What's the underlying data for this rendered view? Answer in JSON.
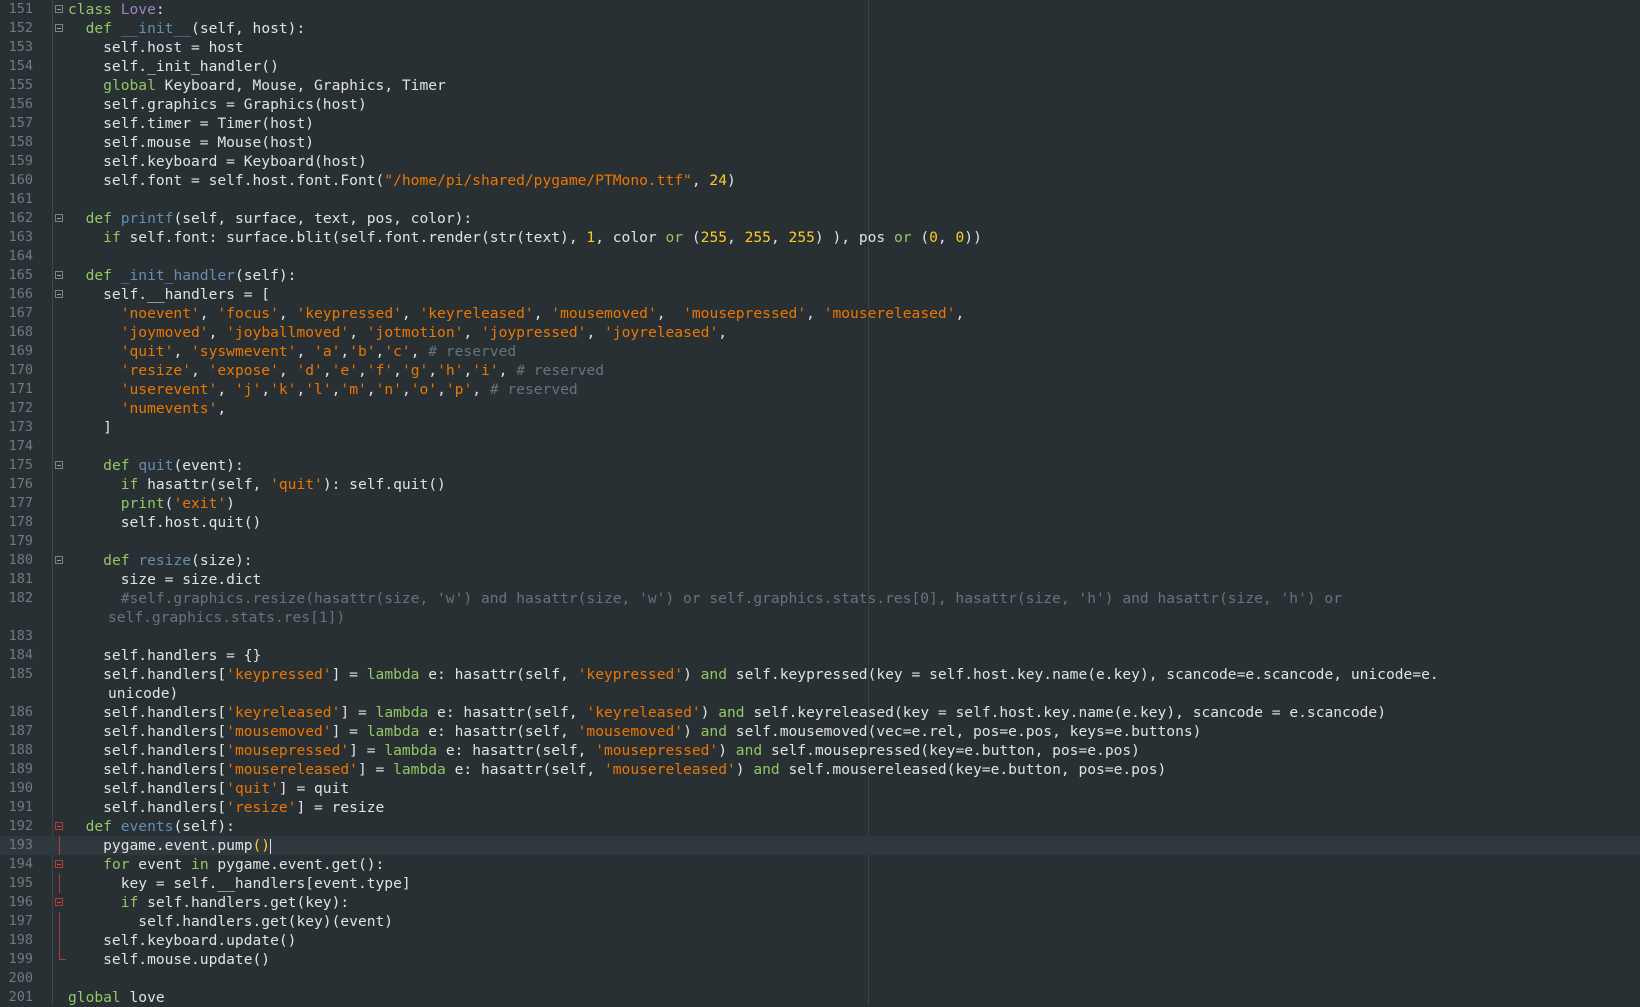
{
  "editor": {
    "lines": [
      {
        "n": "151",
        "fold": "box",
        "tokens": [
          [
            "kw",
            "class "
          ],
          [
            "cl",
            "Love"
          ],
          [
            "",
            ":"
          ]
        ]
      },
      {
        "n": "152",
        "fold": "box",
        "tokens": [
          [
            "",
            "  "
          ],
          [
            "kw",
            "def "
          ],
          [
            "fn",
            "__init__"
          ],
          [
            "",
            "(self, host):"
          ]
        ]
      },
      {
        "n": "153",
        "tokens": [
          [
            "",
            "    self.host = host"
          ]
        ]
      },
      {
        "n": "154",
        "tokens": [
          [
            "",
            "    self._init_handler()"
          ]
        ]
      },
      {
        "n": "155",
        "tokens": [
          [
            "",
            "    "
          ],
          [
            "kw",
            "global"
          ],
          [
            "",
            " Keyboard, Mouse, Graphics, Timer"
          ]
        ]
      },
      {
        "n": "156",
        "tokens": [
          [
            "",
            "    self.graphics = Graphics(host)"
          ]
        ]
      },
      {
        "n": "157",
        "tokens": [
          [
            "",
            "    self.timer = Timer(host)"
          ]
        ]
      },
      {
        "n": "158",
        "tokens": [
          [
            "",
            "    self.mouse = Mouse(host)"
          ]
        ]
      },
      {
        "n": "159",
        "tokens": [
          [
            "",
            "    self.keyboard = Keyboard(host)"
          ]
        ]
      },
      {
        "n": "160",
        "tokens": [
          [
            "",
            "    self.font = self.host.font.Font("
          ],
          [
            "st",
            "\"/home/pi/shared/pygame/PTMono.ttf\""
          ],
          [
            "",
            ", "
          ],
          [
            "nu",
            "24"
          ],
          [
            "",
            ")"
          ]
        ]
      },
      {
        "n": "161",
        "tokens": []
      },
      {
        "n": "162",
        "fold": "box",
        "tokens": [
          [
            "",
            "  "
          ],
          [
            "kw",
            "def "
          ],
          [
            "fn",
            "printf"
          ],
          [
            "",
            "(self, surface, text, pos, color):"
          ]
        ]
      },
      {
        "n": "163",
        "tokens": [
          [
            "",
            "    "
          ],
          [
            "kw",
            "if"
          ],
          [
            "",
            " self.font: surface.blit(self.font.render(str(text), "
          ],
          [
            "nu",
            "1"
          ],
          [
            "",
            ", color "
          ],
          [
            "kw",
            "or"
          ],
          [
            "",
            " ("
          ],
          [
            "nu",
            "255"
          ],
          [
            "",
            ", "
          ],
          [
            "nu",
            "255"
          ],
          [
            "",
            ", "
          ],
          [
            "nu",
            "255"
          ],
          [
            "",
            ") ), pos "
          ],
          [
            "kw",
            "or"
          ],
          [
            "",
            " ("
          ],
          [
            "nu",
            "0"
          ],
          [
            "",
            ", "
          ],
          [
            "nu",
            "0"
          ],
          [
            "",
            "))"
          ]
        ]
      },
      {
        "n": "164",
        "tokens": []
      },
      {
        "n": "165",
        "fold": "box",
        "tokens": [
          [
            "",
            "  "
          ],
          [
            "kw",
            "def "
          ],
          [
            "fn",
            "_init_handler"
          ],
          [
            "",
            "(self):"
          ]
        ]
      },
      {
        "n": "166",
        "fold": "box",
        "tokens": [
          [
            "",
            "    self.__handlers = ["
          ]
        ]
      },
      {
        "n": "167",
        "tokens": [
          [
            "",
            "      "
          ],
          [
            "st",
            "'noevent'"
          ],
          [
            "",
            ", "
          ],
          [
            "st",
            "'focus'"
          ],
          [
            "",
            ", "
          ],
          [
            "st",
            "'keypressed'"
          ],
          [
            "",
            ", "
          ],
          [
            "st",
            "'keyreleased'"
          ],
          [
            "",
            ", "
          ],
          [
            "st",
            "'mousemoved'"
          ],
          [
            "",
            ",  "
          ],
          [
            "st",
            "'mousepressed'"
          ],
          [
            "",
            ", "
          ],
          [
            "st",
            "'mousereleased'"
          ],
          [
            "",
            ","
          ]
        ]
      },
      {
        "n": "168",
        "tokens": [
          [
            "",
            "      "
          ],
          [
            "st",
            "'joymoved'"
          ],
          [
            "",
            ", "
          ],
          [
            "st",
            "'joyballmoved'"
          ],
          [
            "",
            ", "
          ],
          [
            "st",
            "'jotmotion'"
          ],
          [
            "",
            ", "
          ],
          [
            "st",
            "'joypressed'"
          ],
          [
            "",
            ", "
          ],
          [
            "st",
            "'joyreleased'"
          ],
          [
            "",
            ","
          ]
        ]
      },
      {
        "n": "169",
        "tokens": [
          [
            "",
            "      "
          ],
          [
            "st",
            "'quit'"
          ],
          [
            "",
            ", "
          ],
          [
            "st",
            "'syswmevent'"
          ],
          [
            "",
            ", "
          ],
          [
            "st",
            "'a'"
          ],
          [
            "",
            ","
          ],
          [
            "st",
            "'b'"
          ],
          [
            "",
            ","
          ],
          [
            "st",
            "'c'"
          ],
          [
            "",
            ", "
          ],
          [
            "cm",
            "# reserved"
          ]
        ]
      },
      {
        "n": "170",
        "tokens": [
          [
            "",
            "      "
          ],
          [
            "st",
            "'resize'"
          ],
          [
            "",
            ", "
          ],
          [
            "st",
            "'expose'"
          ],
          [
            "",
            ", "
          ],
          [
            "st",
            "'d'"
          ],
          [
            "",
            ","
          ],
          [
            "st",
            "'e'"
          ],
          [
            "",
            ","
          ],
          [
            "st",
            "'f'"
          ],
          [
            "",
            ","
          ],
          [
            "st",
            "'g'"
          ],
          [
            "",
            ","
          ],
          [
            "st",
            "'h'"
          ],
          [
            "",
            ","
          ],
          [
            "st",
            "'i'"
          ],
          [
            "",
            ", "
          ],
          [
            "cm",
            "# reserved"
          ]
        ]
      },
      {
        "n": "171",
        "tokens": [
          [
            "",
            "      "
          ],
          [
            "st",
            "'userevent'"
          ],
          [
            "",
            ", "
          ],
          [
            "st",
            "'j'"
          ],
          [
            "",
            ","
          ],
          [
            "st",
            "'k'"
          ],
          [
            "",
            ","
          ],
          [
            "st",
            "'l'"
          ],
          [
            "",
            ","
          ],
          [
            "st",
            "'m'"
          ],
          [
            "",
            ","
          ],
          [
            "st",
            "'n'"
          ],
          [
            "",
            ","
          ],
          [
            "st",
            "'o'"
          ],
          [
            "",
            ","
          ],
          [
            "st",
            "'p'"
          ],
          [
            "",
            ", "
          ],
          [
            "cm",
            "# reserved"
          ]
        ]
      },
      {
        "n": "172",
        "tokens": [
          [
            "",
            "      "
          ],
          [
            "st",
            "'numevents'"
          ],
          [
            "",
            ","
          ]
        ]
      },
      {
        "n": "173",
        "tokens": [
          [
            "",
            "    ]"
          ]
        ]
      },
      {
        "n": "174",
        "tokens": []
      },
      {
        "n": "175",
        "fold": "box",
        "tokens": [
          [
            "",
            "    "
          ],
          [
            "kw",
            "def "
          ],
          [
            "fn",
            "quit"
          ],
          [
            "",
            "(event):"
          ]
        ]
      },
      {
        "n": "176",
        "tokens": [
          [
            "",
            "      "
          ],
          [
            "kw",
            "if"
          ],
          [
            "",
            " hasattr(self, "
          ],
          [
            "st",
            "'quit'"
          ],
          [
            "",
            "): self.quit()"
          ]
        ]
      },
      {
        "n": "177",
        "tokens": [
          [
            "",
            "      "
          ],
          [
            "kw",
            "print"
          ],
          [
            "",
            "("
          ],
          [
            "st",
            "'exit'"
          ],
          [
            "",
            ")"
          ]
        ]
      },
      {
        "n": "178",
        "tokens": [
          [
            "",
            "      self.host.quit()"
          ]
        ]
      },
      {
        "n": "179",
        "tokens": []
      },
      {
        "n": "180",
        "fold": "box",
        "tokens": [
          [
            "",
            "    "
          ],
          [
            "kw",
            "def "
          ],
          [
            "fn",
            "resize"
          ],
          [
            "",
            "(size):"
          ]
        ]
      },
      {
        "n": "181",
        "tokens": [
          [
            "",
            "      size = size.dict"
          ]
        ]
      },
      {
        "n": "182",
        "wrap": true,
        "tokens": [
          [
            "",
            "      "
          ],
          [
            "cm",
            "#self.graphics.resize(hasattr(size, 'w') and hasattr(size, 'w') or self.graphics.stats.res[0], hasattr(size, 'h') and hasattr(size, 'h') or "
          ]
        ],
        "cont": [
          [
            "cm",
            "self.graphics.stats.res[1])"
          ]
        ]
      },
      {
        "n": "183",
        "tokens": []
      },
      {
        "n": "184",
        "tokens": [
          [
            "",
            "    self.handlers = {}"
          ]
        ]
      },
      {
        "n": "185",
        "wrap": true,
        "tokens": [
          [
            "",
            "    self.handlers["
          ],
          [
            "st",
            "'keypressed'"
          ],
          [
            "",
            "] = "
          ],
          [
            "kw",
            "lambda"
          ],
          [
            "",
            " e: hasattr(self, "
          ],
          [
            "st",
            "'keypressed'"
          ],
          [
            "",
            ") "
          ],
          [
            "kw",
            "and"
          ],
          [
            "",
            " self.keypressed(key = self.host.key.name(e.key), scancode=e.scancode, unicode=e."
          ]
        ],
        "cont": [
          [
            "",
            "unicode)"
          ]
        ]
      },
      {
        "n": "186",
        "tokens": [
          [
            "",
            "    self.handlers["
          ],
          [
            "st",
            "'keyreleased'"
          ],
          [
            "",
            "] = "
          ],
          [
            "kw",
            "lambda"
          ],
          [
            "",
            " e: hasattr(self, "
          ],
          [
            "st",
            "'keyreleased'"
          ],
          [
            "",
            ") "
          ],
          [
            "kw",
            "and"
          ],
          [
            "",
            " self.keyreleased(key = self.host.key.name(e.key), scancode = e.scancode)"
          ]
        ]
      },
      {
        "n": "187",
        "tokens": [
          [
            "",
            "    self.handlers["
          ],
          [
            "st",
            "'mousemoved'"
          ],
          [
            "",
            "] = "
          ],
          [
            "kw",
            "lambda"
          ],
          [
            "",
            " e: hasattr(self, "
          ],
          [
            "st",
            "'mousemoved'"
          ],
          [
            "",
            ") "
          ],
          [
            "kw",
            "and"
          ],
          [
            "",
            " self.mousemoved(vec=e.rel, pos=e.pos, keys=e.buttons)"
          ]
        ]
      },
      {
        "n": "188",
        "tokens": [
          [
            "",
            "    self.handlers["
          ],
          [
            "st",
            "'mousepressed'"
          ],
          [
            "",
            "] = "
          ],
          [
            "kw",
            "lambda"
          ],
          [
            "",
            " e: hasattr(self, "
          ],
          [
            "st",
            "'mousepressed'"
          ],
          [
            "",
            ") "
          ],
          [
            "kw",
            "and"
          ],
          [
            "",
            " self.mousepressed(key=e.button, pos=e.pos)"
          ]
        ]
      },
      {
        "n": "189",
        "tokens": [
          [
            "",
            "    self.handlers["
          ],
          [
            "st",
            "'mousereleased'"
          ],
          [
            "",
            "] = "
          ],
          [
            "kw",
            "lambda"
          ],
          [
            "",
            " e: hasattr(self, "
          ],
          [
            "st",
            "'mousereleased'"
          ],
          [
            "",
            ") "
          ],
          [
            "kw",
            "and"
          ],
          [
            "",
            " self.mousereleased(key=e.button, pos=e.pos)"
          ]
        ]
      },
      {
        "n": "190",
        "tokens": [
          [
            "",
            "    self.handlers["
          ],
          [
            "st",
            "'quit'"
          ],
          [
            "",
            "] = quit"
          ]
        ]
      },
      {
        "n": "191",
        "tokens": [
          [
            "",
            "    self.handlers["
          ],
          [
            "st",
            "'resize'"
          ],
          [
            "",
            "] = resize"
          ]
        ]
      },
      {
        "n": "192",
        "fold": "red",
        "tokens": [
          [
            "",
            "  "
          ],
          [
            "kw",
            "def "
          ],
          [
            "fn",
            "events"
          ],
          [
            "",
            "(self):"
          ]
        ]
      },
      {
        "n": "193",
        "current": true,
        "bracket": "mid",
        "tokens": [
          [
            "",
            "    pygame.event.pump"
          ],
          [
            "nu",
            "()"
          ]
        ]
      },
      {
        "n": "194",
        "fold": "red",
        "tokens": [
          [
            "",
            "    "
          ],
          [
            "kw",
            "for"
          ],
          [
            "",
            " event "
          ],
          [
            "kw",
            "in"
          ],
          [
            "",
            " pygame.event.get():"
          ]
        ]
      },
      {
        "n": "195",
        "bracket": "mid",
        "tokens": [
          [
            "",
            "      key = self.__handlers[event.type]"
          ]
        ]
      },
      {
        "n": "196",
        "fold": "red",
        "tokens": [
          [
            "",
            "      "
          ],
          [
            "kw",
            "if"
          ],
          [
            "",
            " self.handlers.get(key):"
          ]
        ]
      },
      {
        "n": "197",
        "bracket": "mid",
        "tokens": [
          [
            "",
            "        self.handlers.get(key)(event)"
          ]
        ]
      },
      {
        "n": "198",
        "bracket": "mid",
        "tokens": [
          [
            "",
            "    self.keyboard.update()"
          ]
        ]
      },
      {
        "n": "199",
        "bracket": "end",
        "tokens": [
          [
            "",
            "    self.mouse.update()"
          ]
        ]
      },
      {
        "n": "200",
        "tokens": []
      },
      {
        "n": "201",
        "tokens": [
          [
            "kw",
            "global"
          ],
          [
            "",
            " love"
          ]
        ]
      }
    ]
  }
}
